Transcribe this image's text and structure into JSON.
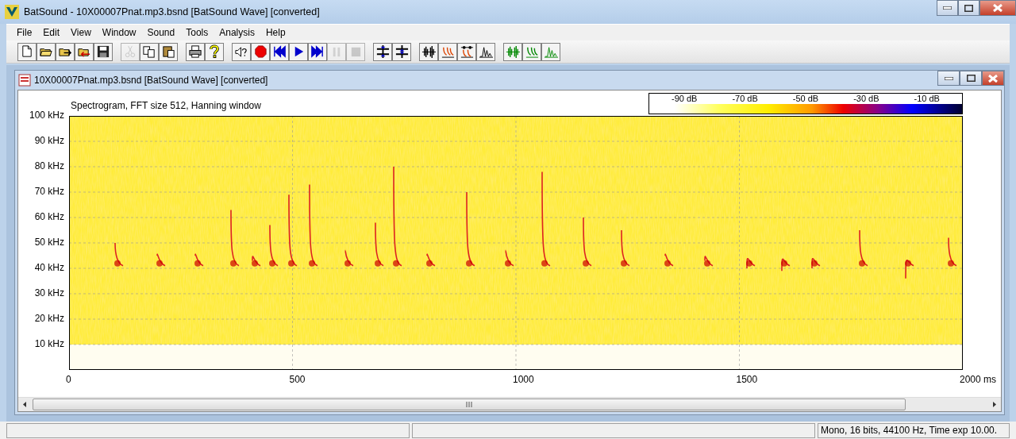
{
  "window": {
    "title": "BatSound - 10X00007Pnat.mp3.bsnd [BatSound Wave] [converted]"
  },
  "menu": [
    "File",
    "Edit",
    "View",
    "Window",
    "Sound",
    "Tools",
    "Analysis",
    "Help"
  ],
  "toolbar_groups": [
    [
      {
        "kind": "new",
        "disabled": false
      },
      {
        "kind": "open",
        "disabled": false
      },
      {
        "kind": "open-next",
        "disabled": false
      },
      {
        "kind": "open-prev",
        "disabled": false
      },
      {
        "kind": "save",
        "disabled": false
      }
    ],
    [
      {
        "kind": "cut",
        "disabled": true
      },
      {
        "kind": "copy",
        "disabled": false
      },
      {
        "kind": "paste",
        "disabled": false
      }
    ],
    [
      {
        "kind": "print",
        "disabled": false
      },
      {
        "kind": "help",
        "disabled": false
      }
    ],
    [
      {
        "kind": "speaker",
        "disabled": false
      },
      {
        "kind": "record",
        "disabled": false
      },
      {
        "kind": "rewind",
        "disabled": false
      },
      {
        "kind": "play",
        "disabled": false
      },
      {
        "kind": "forward",
        "disabled": false
      },
      {
        "kind": "pause",
        "disabled": true
      },
      {
        "kind": "stop",
        "disabled": true
      }
    ],
    [
      {
        "kind": "zoom-in-v",
        "disabled": false
      },
      {
        "kind": "zoom-out-v",
        "disabled": false
      }
    ],
    [
      {
        "kind": "wave",
        "disabled": false
      },
      {
        "kind": "sono",
        "disabled": false
      },
      {
        "kind": "sono-cursor",
        "disabled": false
      },
      {
        "kind": "power",
        "disabled": false
      }
    ],
    [
      {
        "kind": "wave-green",
        "disabled": false
      },
      {
        "kind": "sono-green",
        "disabled": false
      },
      {
        "kind": "power-green",
        "disabled": false
      }
    ]
  ],
  "child_window": {
    "title": "10X00007Pnat.mp3.bsnd [BatSound Wave] [converted]",
    "plot": {
      "title": "Spectrogram, FFT size 512, Hanning window",
      "colorbar_labels": [
        "-90 dB",
        "-70 dB",
        "-50 dB",
        "-30 dB",
        "-10 dB"
      ],
      "yticks": [
        "100 kHz",
        "90 kHz",
        "80 kHz",
        "70 kHz",
        "60 kHz",
        "50 kHz",
        "40 kHz",
        "30 kHz",
        "20 kHz",
        "10 kHz"
      ],
      "xticks": [
        "0",
        "500",
        "1000",
        "1500",
        "2000 ms"
      ]
    }
  },
  "status_bar": {
    "text": "Mono, 16 bits, 44100 Hz, Time exp 10.00."
  }
}
